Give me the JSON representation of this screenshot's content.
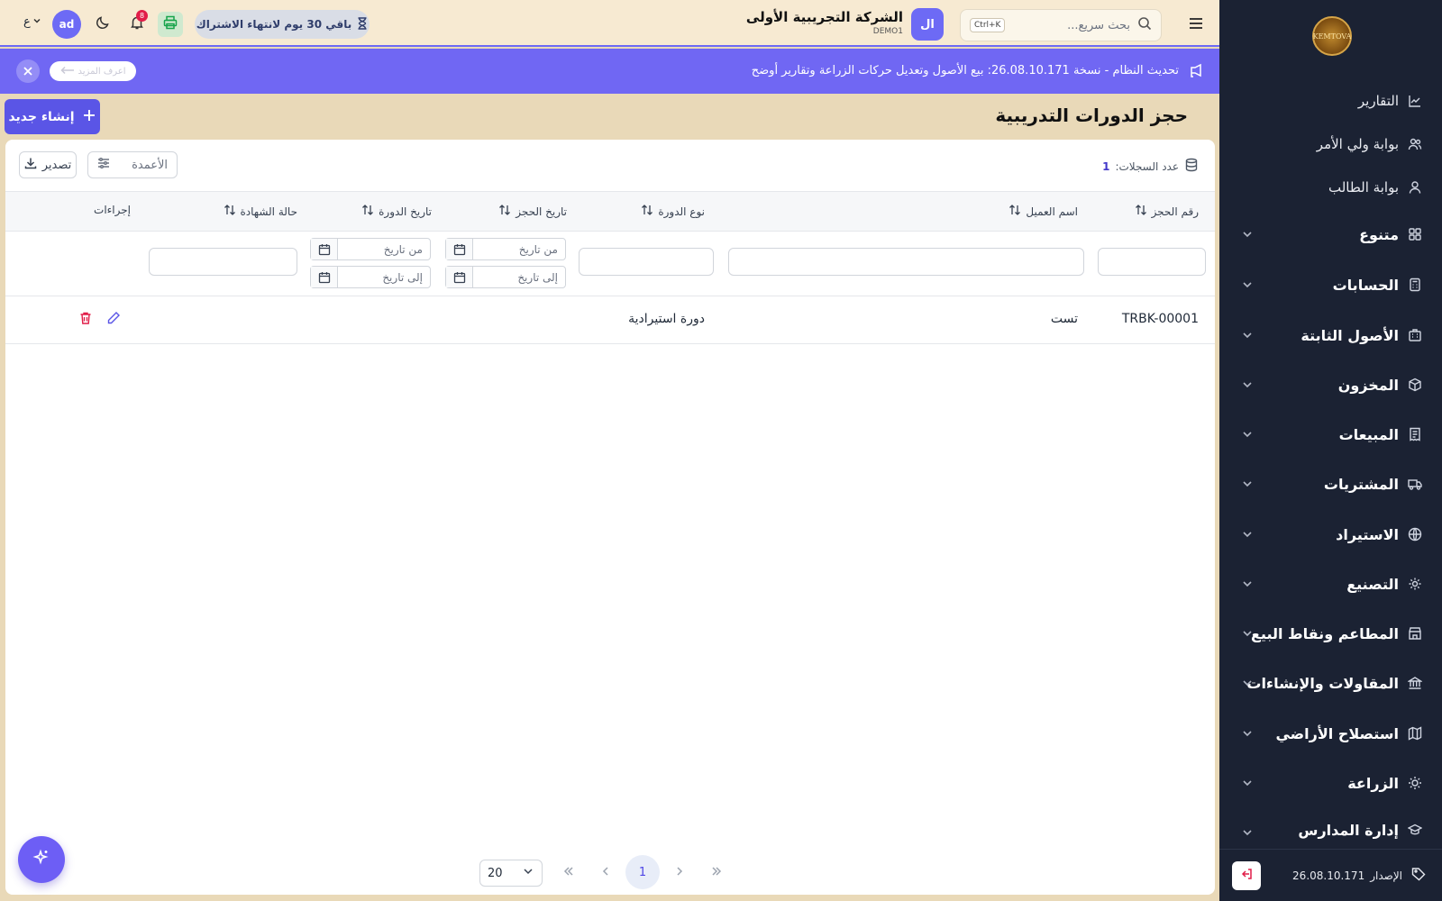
{
  "sidebar": {
    "logo_text": "KEMTOVA",
    "items": [
      {
        "label": "التقارير",
        "icon": "chart-icon"
      },
      {
        "label": "بوابة ولي الأمر",
        "icon": "users-icon"
      },
      {
        "label": "بوابة الطالب",
        "icon": "user-icon"
      }
    ],
    "groups": [
      {
        "label": "متنوع",
        "icon": "grid-icon"
      },
      {
        "label": "الحسابات",
        "icon": "calculator-icon"
      },
      {
        "label": "الأصول الثابتة",
        "icon": "building-icon"
      },
      {
        "label": "المخزون",
        "icon": "box-icon"
      },
      {
        "label": "المبيعات",
        "icon": "receipt-icon"
      },
      {
        "label": "المشتريات",
        "icon": "truck-icon"
      },
      {
        "label": "الاستيراد",
        "icon": "globe-icon"
      },
      {
        "label": "التصنيع",
        "icon": "gear-icon"
      },
      {
        "label": "المطاعم ونقاط البيع",
        "icon": "store-icon"
      },
      {
        "label": "المقاولات والإنشاءات",
        "icon": "bank-icon"
      },
      {
        "label": "استصلاح الأراضي",
        "icon": "map-icon"
      },
      {
        "label": "الزراعة",
        "icon": "sun-icon"
      },
      {
        "label": "إدارة المدارس",
        "icon": "school-icon"
      }
    ],
    "version_label": "الإصدار",
    "version": "26.08.10.171"
  },
  "topbar": {
    "search_placeholder": "بحث سريع...",
    "shortcut": "Ctrl+K",
    "company_initials": "ال",
    "company_name": "الشركة التجريبية الأولى",
    "company_code": "DEMO1",
    "subscription": "باقي 30 يوم لانتهاء الاشتراك",
    "notifications": "8",
    "user_initials": "ad",
    "lang": "ع"
  },
  "banner": {
    "message": "تحديث النظام - نسخة 26.08.10.171: بيع الأصول وتعديل حركات الزراعة وتقارير أوضح",
    "more": "اعرف المزيد"
  },
  "page": {
    "title": "حجز الدورات التدريبية",
    "create_label": "إنشاء جديد",
    "records_label": "عدد السجلات:",
    "records_count": "1",
    "columns_label": "الأعمدة",
    "export_label": "تصدير"
  },
  "table": {
    "headers": {
      "booking_no": "رقم الحجز",
      "client": "اسم العميل",
      "course_type": "نوع الدورة",
      "booking_date": "تاريخ الحجز",
      "course_date": "تاريخ الدورة",
      "cert_status": "حالة الشهادة",
      "actions": "إجراءات"
    },
    "filters": {
      "from": "من تاريخ",
      "to": "إلى تاريخ"
    },
    "rows": [
      {
        "booking_no": "TRBK-00001",
        "client": "تست",
        "course_type": "دورة استيرادية",
        "booking_date": "",
        "course_date": "",
        "cert_status": ""
      }
    ]
  },
  "pagination": {
    "page_size": "20",
    "current": "1"
  },
  "colors": {
    "accent": "#6d6af5",
    "sidebar": "#1b2233",
    "danger": "#e11d48"
  }
}
